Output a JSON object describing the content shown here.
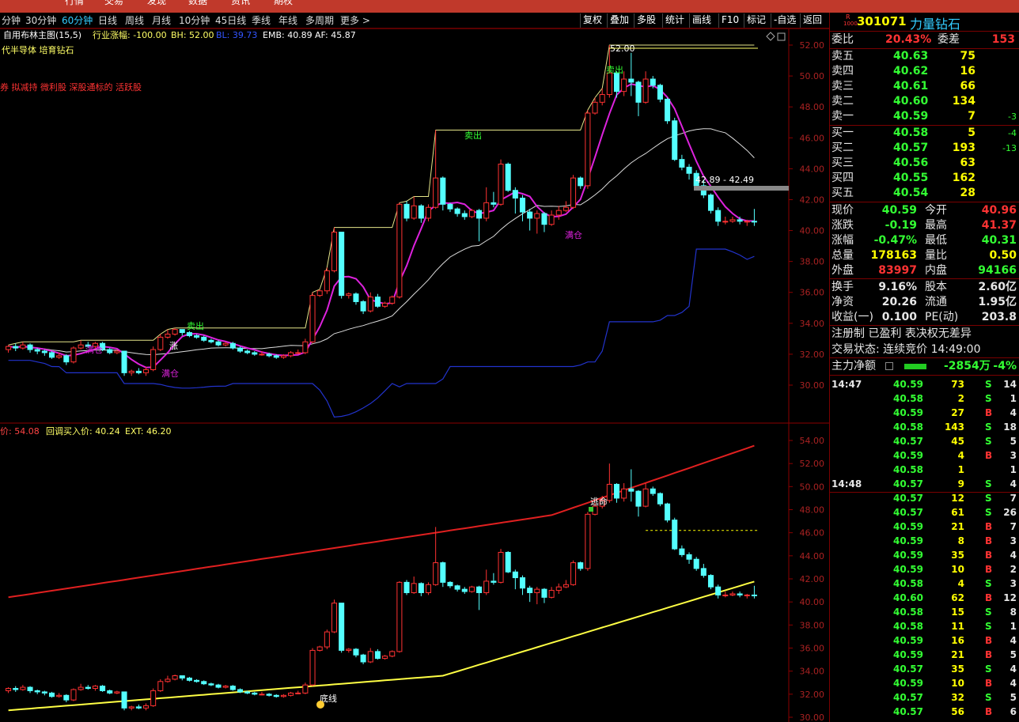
{
  "top_menu": [
    "行情",
    "交易",
    "发现",
    "数据",
    "资讯",
    "期权"
  ],
  "periods": [
    "分钟",
    "30分钟",
    "60分钟",
    "日线",
    "周线",
    "月线",
    "10分钟",
    "45日线",
    "季线",
    "年线",
    "多周期",
    "更多 >"
  ],
  "active_period": "60分钟",
  "tools": [
    "复权",
    "叠加",
    "多股",
    "统计",
    "画线",
    "F10",
    "标记",
    "-自选",
    "返回"
  ],
  "upper_panel": {
    "indicator_name": "自用布林主图(15,5)",
    "industry_change": "行业涨幅: -100.00",
    "bh": "BH: 52.00",
    "bl": "BL: 39.73",
    "emb": "EMB: 40.89",
    "af": "AF: 45.87",
    "concepts": "代半导体 培育钻石",
    "tags": "券 拟减持 微利股 深股通标的 活跃股",
    "annotations": [
      "卖出",
      "卖出",
      "卖出",
      "满仓",
      "满仓",
      "满仓",
      "涨",
      "52.00",
      "42.89 - 42.49"
    ],
    "y_ticks": [
      "52.00",
      "50.00",
      "48.00",
      "46.00",
      "44.00",
      "42.00",
      "40.00",
      "38.00",
      "36.00",
      "34.00",
      "32.00",
      "30.00"
    ]
  },
  "lower_panel": {
    "label_price": "价: 54.08",
    "label_pullback": "回调买入价: 40.24",
    "label_ext": "EXT: 46.20",
    "annotations": [
      "逃命",
      "底线"
    ],
    "y_ticks": [
      "54.00",
      "52.00",
      "50.00",
      "48.00",
      "46.00",
      "44.00",
      "42.00",
      "40.00",
      "38.00",
      "36.00",
      "34.00",
      "32.00",
      "30.00"
    ]
  },
  "chart_data": {
    "type": "candlestick",
    "upper_ymin": 30,
    "upper_ymax": 52,
    "lower_ymin": 30,
    "lower_ymax": 54,
    "candles": [
      [
        32.3,
        32.5,
        32.6,
        32.1
      ],
      [
        32.5,
        32.4,
        32.7,
        32.2
      ],
      [
        32.4,
        32.6,
        32.8,
        32.3
      ],
      [
        32.6,
        32.3,
        32.7,
        32.1
      ],
      [
        32.3,
        32.2,
        32.4,
        32.0
      ],
      [
        32.2,
        32.1,
        32.3,
        31.9
      ],
      [
        32.1,
        31.8,
        32.2,
        31.7
      ],
      [
        31.8,
        31.9,
        32.1,
        31.7
      ],
      [
        31.9,
        31.5,
        32.0,
        31.3
      ],
      [
        31.5,
        32.4,
        32.5,
        31.4
      ],
      [
        32.4,
        32.6,
        32.9,
        32.3
      ],
      [
        32.6,
        32.5,
        32.8,
        32.4
      ],
      [
        32.5,
        32.7,
        32.8,
        32.3
      ],
      [
        32.7,
        32.3,
        32.8,
        32.2
      ],
      [
        32.3,
        32.1,
        32.4,
        32.0
      ],
      [
        32.1,
        32.2,
        32.3,
        32.0
      ],
      [
        32.2,
        30.8,
        32.2,
        30.6
      ],
      [
        30.8,
        30.9,
        31.0,
        30.6
      ],
      [
        30.9,
        30.8,
        31.1,
        30.7
      ],
      [
        30.8,
        31.0,
        31.2,
        30.6
      ],
      [
        31.0,
        32.3,
        32.5,
        30.9
      ],
      [
        32.3,
        33.1,
        33.3,
        32.2
      ],
      [
        33.1,
        33.3,
        33.6,
        33.0
      ],
      [
        33.3,
        33.6,
        33.7,
        33.2
      ],
      [
        33.6,
        33.4,
        33.6,
        33.2
      ],
      [
        33.4,
        33.2,
        33.5,
        33.1
      ],
      [
        33.2,
        33.1,
        33.3,
        33.0
      ],
      [
        33.1,
        32.9,
        33.2,
        32.8
      ],
      [
        32.9,
        32.8,
        33.0,
        32.7
      ],
      [
        32.8,
        32.6,
        32.9,
        32.5
      ],
      [
        32.6,
        32.7,
        32.8,
        32.5
      ],
      [
        32.7,
        32.4,
        32.8,
        32.3
      ],
      [
        32.4,
        32.2,
        32.5,
        32.1
      ],
      [
        32.2,
        32.1,
        32.3,
        32.0
      ],
      [
        32.1,
        32.0,
        32.2,
        31.9
      ],
      [
        32.0,
        32.0,
        32.2,
        31.9
      ],
      [
        32.0,
        31.9,
        32.1,
        31.8
      ],
      [
        31.9,
        31.8,
        32.0,
        31.7
      ],
      [
        31.8,
        31.9,
        32.0,
        31.7
      ],
      [
        31.9,
        32.1,
        32.2,
        31.8
      ],
      [
        32.1,
        32.1,
        32.3,
        32.0
      ],
      [
        32.1,
        32.8,
        33.0,
        32.0
      ],
      [
        32.8,
        35.8,
        36.0,
        32.7
      ],
      [
        35.8,
        36.1,
        36.2,
        35.7
      ],
      [
        36.1,
        37.4,
        37.6,
        35.9
      ],
      [
        37.4,
        39.9,
        40.2,
        37.3
      ],
      [
        39.9,
        35.8,
        39.9,
        35.6
      ],
      [
        35.8,
        35.9,
        36.0,
        35.6
      ],
      [
        35.9,
        35.4,
        36.0,
        35.2
      ],
      [
        35.4,
        34.8,
        35.5,
        34.6
      ],
      [
        34.8,
        35.7,
        36.0,
        34.7
      ],
      [
        35.7,
        35.1,
        35.9,
        35.0
      ],
      [
        35.1,
        35.3,
        35.4,
        35.0
      ],
      [
        35.3,
        35.7,
        35.8,
        35.2
      ],
      [
        35.7,
        41.7,
        41.8,
        35.6
      ],
      [
        41.7,
        40.8,
        41.9,
        40.6
      ],
      [
        40.8,
        41.6,
        42.2,
        40.7
      ],
      [
        41.6,
        40.8,
        41.7,
        40.5
      ],
      [
        40.8,
        41.5,
        41.7,
        40.6
      ],
      [
        41.5,
        43.4,
        46.5,
        41.4
      ],
      [
        43.4,
        41.7,
        43.5,
        41.3
      ],
      [
        41.7,
        41.4,
        41.8,
        41.2
      ],
      [
        41.4,
        41.1,
        41.5,
        40.9
      ],
      [
        41.1,
        40.9,
        41.3,
        40.7
      ],
      [
        40.9,
        41.3,
        41.4,
        40.8
      ],
      [
        41.3,
        40.8,
        41.4,
        39.3
      ],
      [
        40.8,
        41.8,
        42.8,
        40.6
      ],
      [
        41.8,
        41.7,
        42.5,
        41.5
      ],
      [
        41.7,
        44.3,
        44.6,
        41.6
      ],
      [
        44.3,
        42.6,
        44.4,
        42.5
      ],
      [
        42.6,
        42.1,
        42.8,
        41.1
      ],
      [
        42.1,
        41.2,
        42.3,
        40.6
      ],
      [
        41.2,
        40.8,
        41.4,
        40.0
      ],
      [
        40.8,
        41.1,
        41.3,
        39.8
      ],
      [
        41.1,
        40.4,
        41.2,
        39.9
      ],
      [
        40.4,
        41.0,
        41.3,
        40.3
      ],
      [
        41.0,
        41.3,
        41.6,
        40.7
      ],
      [
        41.3,
        41.5,
        41.9,
        41.2
      ],
      [
        41.5,
        43.4,
        43.6,
        41.4
      ],
      [
        43.4,
        42.9,
        43.5,
        42.7
      ],
      [
        42.9,
        47.6,
        47.8,
        42.7
      ],
      [
        47.6,
        48.3,
        48.6,
        47.5
      ],
      [
        48.3,
        48.8,
        49.2,
        48.1
      ],
      [
        48.8,
        50.2,
        52.0,
        48.6
      ],
      [
        50.2,
        49.0,
        50.3,
        48.6
      ],
      [
        49.0,
        49.8,
        50.3,
        48.7
      ],
      [
        49.8,
        49.6,
        51.5,
        48.7
      ],
      [
        49.6,
        48.3,
        49.7,
        47.4
      ],
      [
        48.3,
        49.8,
        50.3,
        48.2
      ],
      [
        49.8,
        49.4,
        50.0,
        49.2
      ],
      [
        49.4,
        48.5,
        49.5,
        48.3
      ],
      [
        48.5,
        47.1,
        48.6,
        46.9
      ],
      [
        47.1,
        44.6,
        47.3,
        44.5
      ],
      [
        44.6,
        44.1,
        44.9,
        43.9
      ],
      [
        44.1,
        43.7,
        44.3,
        43.3
      ],
      [
        43.7,
        42.9,
        43.9,
        42.7
      ],
      [
        42.9,
        42.3,
        43.3,
        42.1
      ],
      [
        42.3,
        41.3,
        42.4,
        41.1
      ],
      [
        41.3,
        40.6,
        41.5,
        40.3
      ],
      [
        40.6,
        40.6,
        40.9,
        40.4
      ],
      [
        40.6,
        40.7,
        40.9,
        40.5
      ],
      [
        40.7,
        40.6,
        40.9,
        40.4
      ],
      [
        40.6,
        40.6,
        40.7,
        40.3
      ],
      [
        40.6,
        40.59,
        41.4,
        40.3
      ]
    ]
  },
  "stock": {
    "code": "301071",
    "name": "力量钻石",
    "badge_top": "R",
    "badge_bottom": "1000",
    "weibi_label": "委比",
    "weibi_val": "20.43%",
    "weicha_label": "委差",
    "weicha_val": "153"
  },
  "orderbook_sell": [
    {
      "label": "卖五",
      "price": "40.63",
      "vol": "75",
      "chg": ""
    },
    {
      "label": "卖四",
      "price": "40.62",
      "vol": "16",
      "chg": ""
    },
    {
      "label": "卖三",
      "price": "40.61",
      "vol": "66",
      "chg": ""
    },
    {
      "label": "卖二",
      "price": "40.60",
      "vol": "134",
      "chg": ""
    },
    {
      "label": "卖一",
      "price": "40.59",
      "vol": "7",
      "chg": "-3"
    }
  ],
  "orderbook_buy": [
    {
      "label": "买一",
      "price": "40.58",
      "vol": "5",
      "chg": "-4"
    },
    {
      "label": "买二",
      "price": "40.57",
      "vol": "193",
      "chg": "-13"
    },
    {
      "label": "买三",
      "price": "40.56",
      "vol": "63",
      "chg": ""
    },
    {
      "label": "买四",
      "price": "40.55",
      "vol": "162",
      "chg": ""
    },
    {
      "label": "买五",
      "price": "40.54",
      "vol": "28",
      "chg": ""
    }
  ],
  "quote": [
    {
      "l1": "现价",
      "v1": "40.59",
      "c1": "g",
      "l2": "今开",
      "v2": "40.96",
      "c2": "r"
    },
    {
      "l1": "涨跌",
      "v1": "-0.19",
      "c1": "g",
      "l2": "最高",
      "v2": "41.37",
      "c2": "r"
    },
    {
      "l1": "涨幅",
      "v1": "-0.47%",
      "c1": "g",
      "l2": "最低",
      "v2": "40.31",
      "c2": "g"
    },
    {
      "l1": "总量",
      "v1": "178163",
      "c1": "y",
      "l2": "量比",
      "v2": "0.50",
      "c2": "y"
    },
    {
      "l1": "外盘",
      "v1": "83997",
      "c1": "r",
      "l2": "内盘",
      "v2": "94166",
      "c2": "g"
    }
  ],
  "fundamentals": [
    {
      "l1": "换手",
      "v1": "9.16%",
      "l2": "股本",
      "v2": "2.60亿"
    },
    {
      "l1": "净资",
      "v1": "20.26",
      "l2": "流通",
      "v2": "1.95亿"
    },
    {
      "l1": "收益(一)",
      "v1": "0.100",
      "l2": "PE(动)",
      "v2": "203.8"
    }
  ],
  "notice": "注册制 已盈利 表决权无差异",
  "trade_status": "交易状态: 连续竞价 14:49:00",
  "main_flow": {
    "label": "主力净额",
    "value": "-2854万",
    "pct": "-4%"
  },
  "ticks": [
    {
      "t": "14:47",
      "p": "40.59",
      "v": "73",
      "s": "S",
      "n": "14"
    },
    {
      "t": "",
      "p": "40.58",
      "v": "2",
      "s": "S",
      "n": "1"
    },
    {
      "t": "",
      "p": "40.59",
      "v": "27",
      "s": "B",
      "n": "4"
    },
    {
      "t": "",
      "p": "40.58",
      "v": "143",
      "s": "S",
      "n": "18"
    },
    {
      "t": "",
      "p": "40.57",
      "v": "45",
      "s": "S",
      "n": "5"
    },
    {
      "t": "",
      "p": "40.59",
      "v": "4",
      "s": "B",
      "n": "3"
    },
    {
      "t": "",
      "p": "40.58",
      "v": "1",
      "s": "",
      "n": "1"
    },
    {
      "t": "14:48",
      "p": "40.57",
      "v": "9",
      "s": "S",
      "n": "4"
    },
    {
      "t": "",
      "p": "40.57",
      "v": "12",
      "s": "S",
      "n": "7"
    },
    {
      "t": "",
      "p": "40.57",
      "v": "61",
      "s": "S",
      "n": "26"
    },
    {
      "t": "",
      "p": "40.59",
      "v": "21",
      "s": "B",
      "n": "7"
    },
    {
      "t": "",
      "p": "40.59",
      "v": "8",
      "s": "B",
      "n": "3"
    },
    {
      "t": "",
      "p": "40.59",
      "v": "35",
      "s": "B",
      "n": "4"
    },
    {
      "t": "",
      "p": "40.59",
      "v": "10",
      "s": "B",
      "n": "2"
    },
    {
      "t": "",
      "p": "40.58",
      "v": "4",
      "s": "S",
      "n": "3"
    },
    {
      "t": "",
      "p": "40.60",
      "v": "62",
      "s": "B",
      "n": "12"
    },
    {
      "t": "",
      "p": "40.58",
      "v": "15",
      "s": "S",
      "n": "8"
    },
    {
      "t": "",
      "p": "40.58",
      "v": "11",
      "s": "S",
      "n": "1"
    },
    {
      "t": "",
      "p": "40.59",
      "v": "16",
      "s": "B",
      "n": "4"
    },
    {
      "t": "",
      "p": "40.59",
      "v": "21",
      "s": "B",
      "n": "5"
    },
    {
      "t": "",
      "p": "40.57",
      "v": "35",
      "s": "S",
      "n": "4"
    },
    {
      "t": "",
      "p": "40.59",
      "v": "10",
      "s": "B",
      "n": "4"
    },
    {
      "t": "",
      "p": "40.57",
      "v": "32",
      "s": "S",
      "n": "5"
    },
    {
      "t": "",
      "p": "40.57",
      "v": "56",
      "s": "B",
      "n": "6"
    }
  ]
}
